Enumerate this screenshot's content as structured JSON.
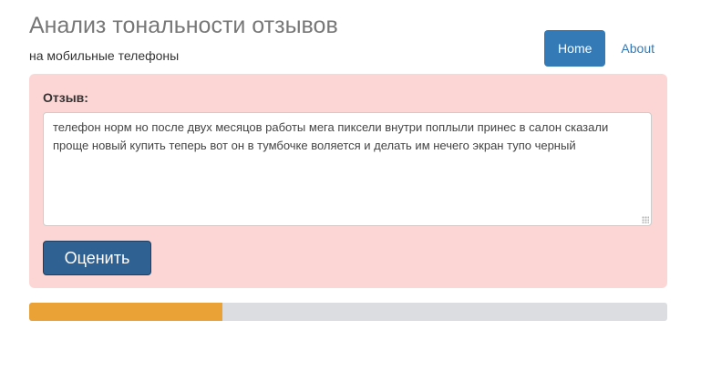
{
  "header": {
    "title": "Анализ тональности отзывов",
    "subtitle": "на мобильные телефоны"
  },
  "nav": {
    "items": [
      {
        "label": "Home",
        "active": true
      },
      {
        "label": "About",
        "active": false
      }
    ]
  },
  "form": {
    "review_label": "Отзыв:",
    "review_text": "телефон норм но после двух месяцов работы мега пиксели внутри поплыли принес в салон сказали проще новый купить теперь вот он в тумбочке воляется и делать им нечего экран тупо черный",
    "submit_label": "Оценить"
  },
  "result": {
    "progress_fraction": 0.303
  },
  "colors": {
    "accent": "#337ab7",
    "panel_background": "#fcd6d5",
    "submit_button": "#2f6193",
    "progress_fill": "#eaa136",
    "progress_track": "#dcdde0"
  }
}
